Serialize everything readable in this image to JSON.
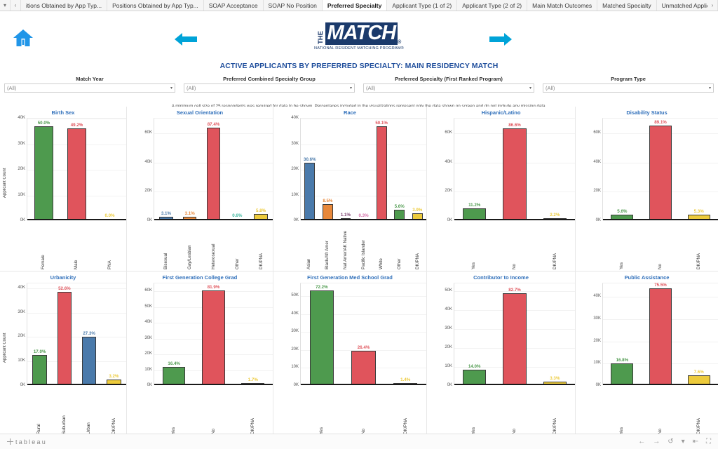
{
  "tabbar": {
    "menu_icon": "chevron-down-icon",
    "scroll_left_icon": "chevron-left-icon",
    "scroll_right_icon": "chevron-right-icon",
    "tabs": [
      {
        "label": "itions Obtained by App Typ...",
        "active": false
      },
      {
        "label": "Positions Obtained by App Typ...",
        "active": false
      },
      {
        "label": "SOAP Acceptance",
        "active": false
      },
      {
        "label": "SOAP No Position",
        "active": false
      },
      {
        "label": "Preferred Specialty",
        "active": true
      },
      {
        "label": "Applicant Type (1 of 2)",
        "active": false
      },
      {
        "label": "Applicant Type (2 of 2)",
        "active": false
      },
      {
        "label": "Main Match Outcomes",
        "active": false
      },
      {
        "label": "Matched Specialty",
        "active": false
      },
      {
        "label": "Unmatched Applicar",
        "active": false
      }
    ]
  },
  "header": {
    "home_icon": "home-icon",
    "prev_icon": "arrow-left-icon",
    "next_icon": "arrow-right-icon",
    "logo": {
      "the": "THE",
      "match": "MATCH",
      "registered": "®",
      "subtitle": "NATIONAL RESIDENT MATCHING PROGRAM®"
    },
    "title": "ACTIVE  APPLICANTS BY PREFERRED SPECIALTY: MAIN RESIDENCY MATCH"
  },
  "filters": [
    {
      "label": "Match Year",
      "value": "(All)",
      "caret": "▾"
    },
    {
      "label": "Preferred Combined Specialty Group",
      "value": "(All)",
      "caret": "▾"
    },
    {
      "label": "Preferred Specialty (First Ranked Program)",
      "value": "(All)",
      "caret": "▾"
    },
    {
      "label": "Program Type",
      "value": "(All)",
      "caret": "▾"
    }
  ],
  "disclaimer": "A minimum cell size of 25 respondents was required for data to be shown. Percentages included in the visualizations represent only the data shown on screen and do not include any missing data.",
  "colors": {
    "green": "#4e9a4e",
    "red": "#e0545c",
    "blue": "#4a7aab",
    "orange": "#e8883a",
    "yellow": "#edcb3c",
    "teal": "#3fb8a0",
    "purple": "#7b3f6e",
    "pink": "#d66fa8",
    "title_blue": "#2f6fba"
  },
  "chart_data": [
    {
      "type": "bar",
      "title": "Birth Sex",
      "ylabel": "Applicant Count",
      "ylim": [
        0,
        40000
      ],
      "yticks": [
        0,
        10000,
        20000,
        30000,
        40000
      ],
      "yticklabels": [
        "0K",
        "10K",
        "20K",
        "30K",
        "40K"
      ],
      "categories": [
        "Female",
        "Male",
        "PNA"
      ],
      "values": [
        36600,
        36000,
        60
      ],
      "labels": [
        "50.0%",
        "49.2%",
        "0.0%"
      ],
      "colors": [
        "#4e9a4e",
        "#e0545c",
        "#edcb3c"
      ],
      "grid": true,
      "legend": "none"
    },
    {
      "type": "bar",
      "title": "Sexual Orientation",
      "ylabel": "",
      "ylim": [
        0,
        70000
      ],
      "yticks": [
        0,
        20000,
        40000,
        60000
      ],
      "yticklabels": [
        "0K",
        "20K",
        "40K",
        "60K"
      ],
      "categories": [
        "Bisexual",
        "Gay/Lesbian",
        "Heterosexual",
        "Other",
        "DK/PNA"
      ],
      "values": [
        2250,
        2250,
        63500,
        440,
        4200
      ],
      "labels": [
        "3.1%",
        "3.1%",
        "87.4%",
        "0.6%",
        "5.8%"
      ],
      "colors": [
        "#4a7aab",
        "#e8883a",
        "#e0545c",
        "#3fb8a0",
        "#edcb3c"
      ],
      "grid": true,
      "legend": "none"
    },
    {
      "type": "bar",
      "title": "Race",
      "ylabel": "",
      "ylim": [
        0,
        40000
      ],
      "yticks": [
        0,
        10000,
        20000,
        30000,
        40000
      ],
      "yticklabels": [
        "0K",
        "10K",
        "20K",
        "30K",
        "40K"
      ],
      "categories": [
        "Asian",
        "Black/Afr Amer",
        "Nat Amer/AK Native",
        "Pacific Islander",
        "White",
        "Other",
        "DK/PNA"
      ],
      "values": [
        22400,
        6200,
        800,
        220,
        36700,
        4100,
        2850
      ],
      "labels": [
        "30.6%",
        "8.5%",
        "1.1%",
        "0.3%",
        "50.1%",
        "5.6%",
        "3.9%"
      ],
      "colors": [
        "#4a7aab",
        "#e8883a",
        "#7b3f6e",
        "#d66fa8",
        "#e0545c",
        "#4e9a4e",
        "#edcb3c"
      ],
      "grid": true,
      "legend": "none"
    },
    {
      "type": "bar",
      "title": "Hispanic/Latino",
      "ylabel": "",
      "ylim": [
        0,
        70000
      ],
      "yticks": [
        0,
        20000,
        40000,
        60000
      ],
      "yticklabels": [
        "0K",
        "20K",
        "40K",
        "60K"
      ],
      "categories": [
        "Yes",
        "No",
        "DK/PNA"
      ],
      "values": [
        8150,
        62900,
        1600
      ],
      "labels": [
        "11.2%",
        "86.6%",
        "2.2%"
      ],
      "colors": [
        "#4e9a4e",
        "#e0545c",
        "#edcb3c"
      ],
      "grid": true,
      "legend": "none"
    },
    {
      "type": "bar",
      "title": "Disability Status",
      "ylabel": "",
      "ylim": [
        0,
        70000
      ],
      "yticks": [
        0,
        20000,
        40000,
        60000
      ],
      "yticklabels": [
        "0K",
        "20K",
        "40K",
        "60K"
      ],
      "categories": [
        "Yes",
        "No",
        "DK/PNA"
      ],
      "values": [
        4050,
        64500,
        3850
      ],
      "labels": [
        "5.6%",
        "89.1%",
        "5.3%"
      ],
      "colors": [
        "#4e9a4e",
        "#e0545c",
        "#edcb3c"
      ],
      "grid": true,
      "legend": "none"
    },
    {
      "type": "bar",
      "title": "Urbanicity",
      "ylabel": "Applicant Count",
      "ylim": [
        0,
        42000
      ],
      "yticks": [
        0,
        10000,
        20000,
        30000,
        40000
      ],
      "yticklabels": [
        "0K",
        "10K",
        "20K",
        "30K",
        "40K"
      ],
      "categories": [
        "Rural",
        "Suburban",
        "Urban",
        "DK/PNA"
      ],
      "values": [
        12400,
        38400,
        19900,
        2350
      ],
      "labels": [
        "17.0%",
        "52.6%",
        "27.3%",
        "3.2%"
      ],
      "colors": [
        "#4e9a4e",
        "#e0545c",
        "#4a7aab",
        "#edcb3c"
      ],
      "grid": true,
      "legend": "none"
    },
    {
      "type": "bar",
      "title": "First Generation College Grad",
      "ylabel": "",
      "ylim": [
        0,
        65000
      ],
      "yticks": [
        0,
        10000,
        20000,
        30000,
        40000,
        50000,
        60000
      ],
      "yticklabels": [
        "0K",
        "10K",
        "20K",
        "30K",
        "40K",
        "50K",
        "60K"
      ],
      "categories": [
        "Yes",
        "No",
        "DK/PNA"
      ],
      "values": [
        11600,
        60300,
        1250
      ],
      "labels": [
        "16.4%",
        "81.9%",
        "1.7%"
      ],
      "colors": [
        "#4e9a4e",
        "#e0545c",
        "#edcb3c"
      ],
      "grid": true,
      "legend": "none"
    },
    {
      "type": "bar",
      "title": "First Generation Med School Grad",
      "ylabel": "",
      "ylim": [
        0,
        57000
      ],
      "yticks": [
        0,
        10000,
        20000,
        30000,
        40000,
        50000
      ],
      "yticklabels": [
        "0K",
        "10K",
        "20K",
        "30K",
        "40K",
        "50K"
      ],
      "categories": [
        "Yes",
        "No",
        "DK/PNA"
      ],
      "values": [
        52600,
        19200,
        1000
      ],
      "labels": [
        "72.2%",
        "26.4%",
        "1.4%"
      ],
      "colors": [
        "#4e9a4e",
        "#e0545c",
        "#edcb3c"
      ],
      "grid": true,
      "legend": "none"
    },
    {
      "type": "bar",
      "title": "Contributor to Income",
      "ylabel": "",
      "ylim": [
        0,
        54000
      ],
      "yticks": [
        0,
        10000,
        20000,
        30000,
        40000,
        50000
      ],
      "yticklabels": [
        "0K",
        "10K",
        "20K",
        "30K",
        "40K",
        "50K"
      ],
      "categories": [
        "Yes",
        "No",
        "DK/PNA"
      ],
      "values": [
        8200,
        48400,
        1950
      ],
      "labels": [
        "14.0%",
        "82.7%",
        "3.3%"
      ],
      "colors": [
        "#4e9a4e",
        "#e0545c",
        "#edcb3c"
      ],
      "grid": true,
      "legend": "none"
    },
    {
      "type": "bar",
      "title": "Public Assistance",
      "ylabel": "",
      "ylim": [
        0,
        46000
      ],
      "yticks": [
        0,
        10000,
        20000,
        30000,
        40000
      ],
      "yticklabels": [
        "0K",
        "10K",
        "20K",
        "30K",
        "40K"
      ],
      "categories": [
        "Yes",
        "No",
        "DK/PNA"
      ],
      "values": [
        9900,
        44400,
        4450
      ],
      "labels": [
        "16.8%",
        "75.5%",
        "7.6%"
      ],
      "colors": [
        "#4e9a4e",
        "#e0545c",
        "#edcb3c"
      ],
      "grid": true,
      "legend": "none"
    }
  ],
  "statusbar": {
    "brand": "tableau",
    "icons": [
      {
        "name": "back-arrow-icon",
        "glyph": "←"
      },
      {
        "name": "forward-arrow-icon",
        "glyph": "→"
      },
      {
        "name": "revert-icon",
        "glyph": "↺"
      },
      {
        "name": "revert-caret-icon",
        "glyph": "▾"
      },
      {
        "name": "refresh-icon",
        "glyph": "⇤"
      },
      {
        "name": "fullscreen-icon",
        "glyph": "⛶"
      }
    ]
  }
}
